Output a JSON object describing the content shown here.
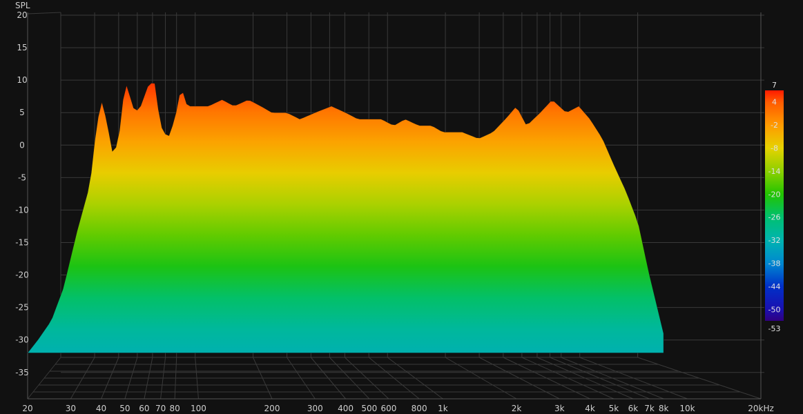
{
  "chart_data": {
    "type": "waterfall",
    "ylabel": "SPL",
    "xlabel": "",
    "ylim": [
      -38,
      20
    ],
    "y_ticks": [
      20,
      15,
      10,
      5,
      0,
      -5,
      -10,
      -15,
      -20,
      -25,
      -30,
      -35
    ],
    "x_scale": "log",
    "xlim": [
      20,
      20000
    ],
    "x_ticks": [
      {
        "value": 20,
        "label": "20"
      },
      {
        "value": 30,
        "label": "30"
      },
      {
        "value": 40,
        "label": "40"
      },
      {
        "value": 50,
        "label": "50"
      },
      {
        "value": 60,
        "label": "60"
      },
      {
        "value": 70,
        "label": "70"
      },
      {
        "value": 80,
        "label": "80"
      },
      {
        "value": 100,
        "label": "100"
      },
      {
        "value": 200,
        "label": "200"
      },
      {
        "value": 300,
        "label": "300"
      },
      {
        "value": 400,
        "label": "400"
      },
      {
        "value": 500,
        "label": "500"
      },
      {
        "value": 600,
        "label": "600"
      },
      {
        "value": 800,
        "label": "800"
      },
      {
        "value": 1000,
        "label": "1k"
      },
      {
        "value": 2000,
        "label": "2k"
      },
      {
        "value": 3000,
        "label": "3k"
      },
      {
        "value": 4000,
        "label": "4k"
      },
      {
        "value": 5000,
        "label": "5k"
      },
      {
        "value": 6000,
        "label": "6k"
      },
      {
        "value": 7000,
        "label": "7k"
      },
      {
        "value": 8000,
        "label": "8k"
      },
      {
        "value": 10000,
        "label": "10k"
      },
      {
        "value": 20000,
        "label": "20kHz"
      }
    ],
    "front_response": {
      "freq": [
        20,
        22,
        25,
        28,
        32,
        36,
        38,
        40,
        42,
        45,
        48,
        50,
        52,
        55,
        58,
        62,
        66,
        70,
        75,
        80,
        85,
        90,
        100,
        110,
        125,
        140,
        160,
        180,
        200,
        230,
        260,
        300,
        350,
        400,
        450,
        500,
        560,
        630,
        700,
        800,
        900,
        1000,
        1200,
        1400,
        1600,
        1800,
        2000,
        2200,
        2500,
        2800,
        3200,
        3600,
        4000,
        4500,
        5000,
        5600,
        6300,
        7000,
        8000
      ],
      "spl": [
        -32,
        -30,
        -27,
        -22,
        -13,
        -6,
        2,
        7,
        4,
        -2,
        3,
        10,
        8,
        5,
        6,
        9,
        10,
        3,
        1,
        4,
        9,
        6,
        6,
        6,
        7,
        6,
        7,
        6,
        5,
        5,
        4,
        5,
        6,
        5,
        4,
        4,
        4,
        3,
        4,
        3,
        3,
        2,
        2,
        1,
        2,
        4,
        6,
        3,
        5,
        7,
        5,
        6,
        4,
        1,
        -3,
        -7,
        -12,
        -20,
        -29
      ]
    },
    "slices": 90,
    "floor_spl": -32,
    "colorbar": {
      "ticks": [
        7,
        4,
        -2,
        -8,
        -14,
        -20,
        -26,
        -32,
        -38,
        -44,
        -50,
        -53
      ],
      "colors": [
        {
          "value": 7,
          "color": "#ff1a00"
        },
        {
          "value": 4,
          "color": "#ff5a00"
        },
        {
          "value": -2,
          "color": "#ff9a00"
        },
        {
          "value": -8,
          "color": "#e6d200"
        },
        {
          "value": -14,
          "color": "#8ed000"
        },
        {
          "value": -20,
          "color": "#22c400"
        },
        {
          "value": -26,
          "color": "#00c070"
        },
        {
          "value": -32,
          "color": "#00b4b0"
        },
        {
          "value": -38,
          "color": "#0088d0"
        },
        {
          "value": -44,
          "color": "#0030c8"
        },
        {
          "value": -50,
          "color": "#1a10b0"
        },
        {
          "value": -53,
          "color": "#300080"
        }
      ]
    }
  }
}
